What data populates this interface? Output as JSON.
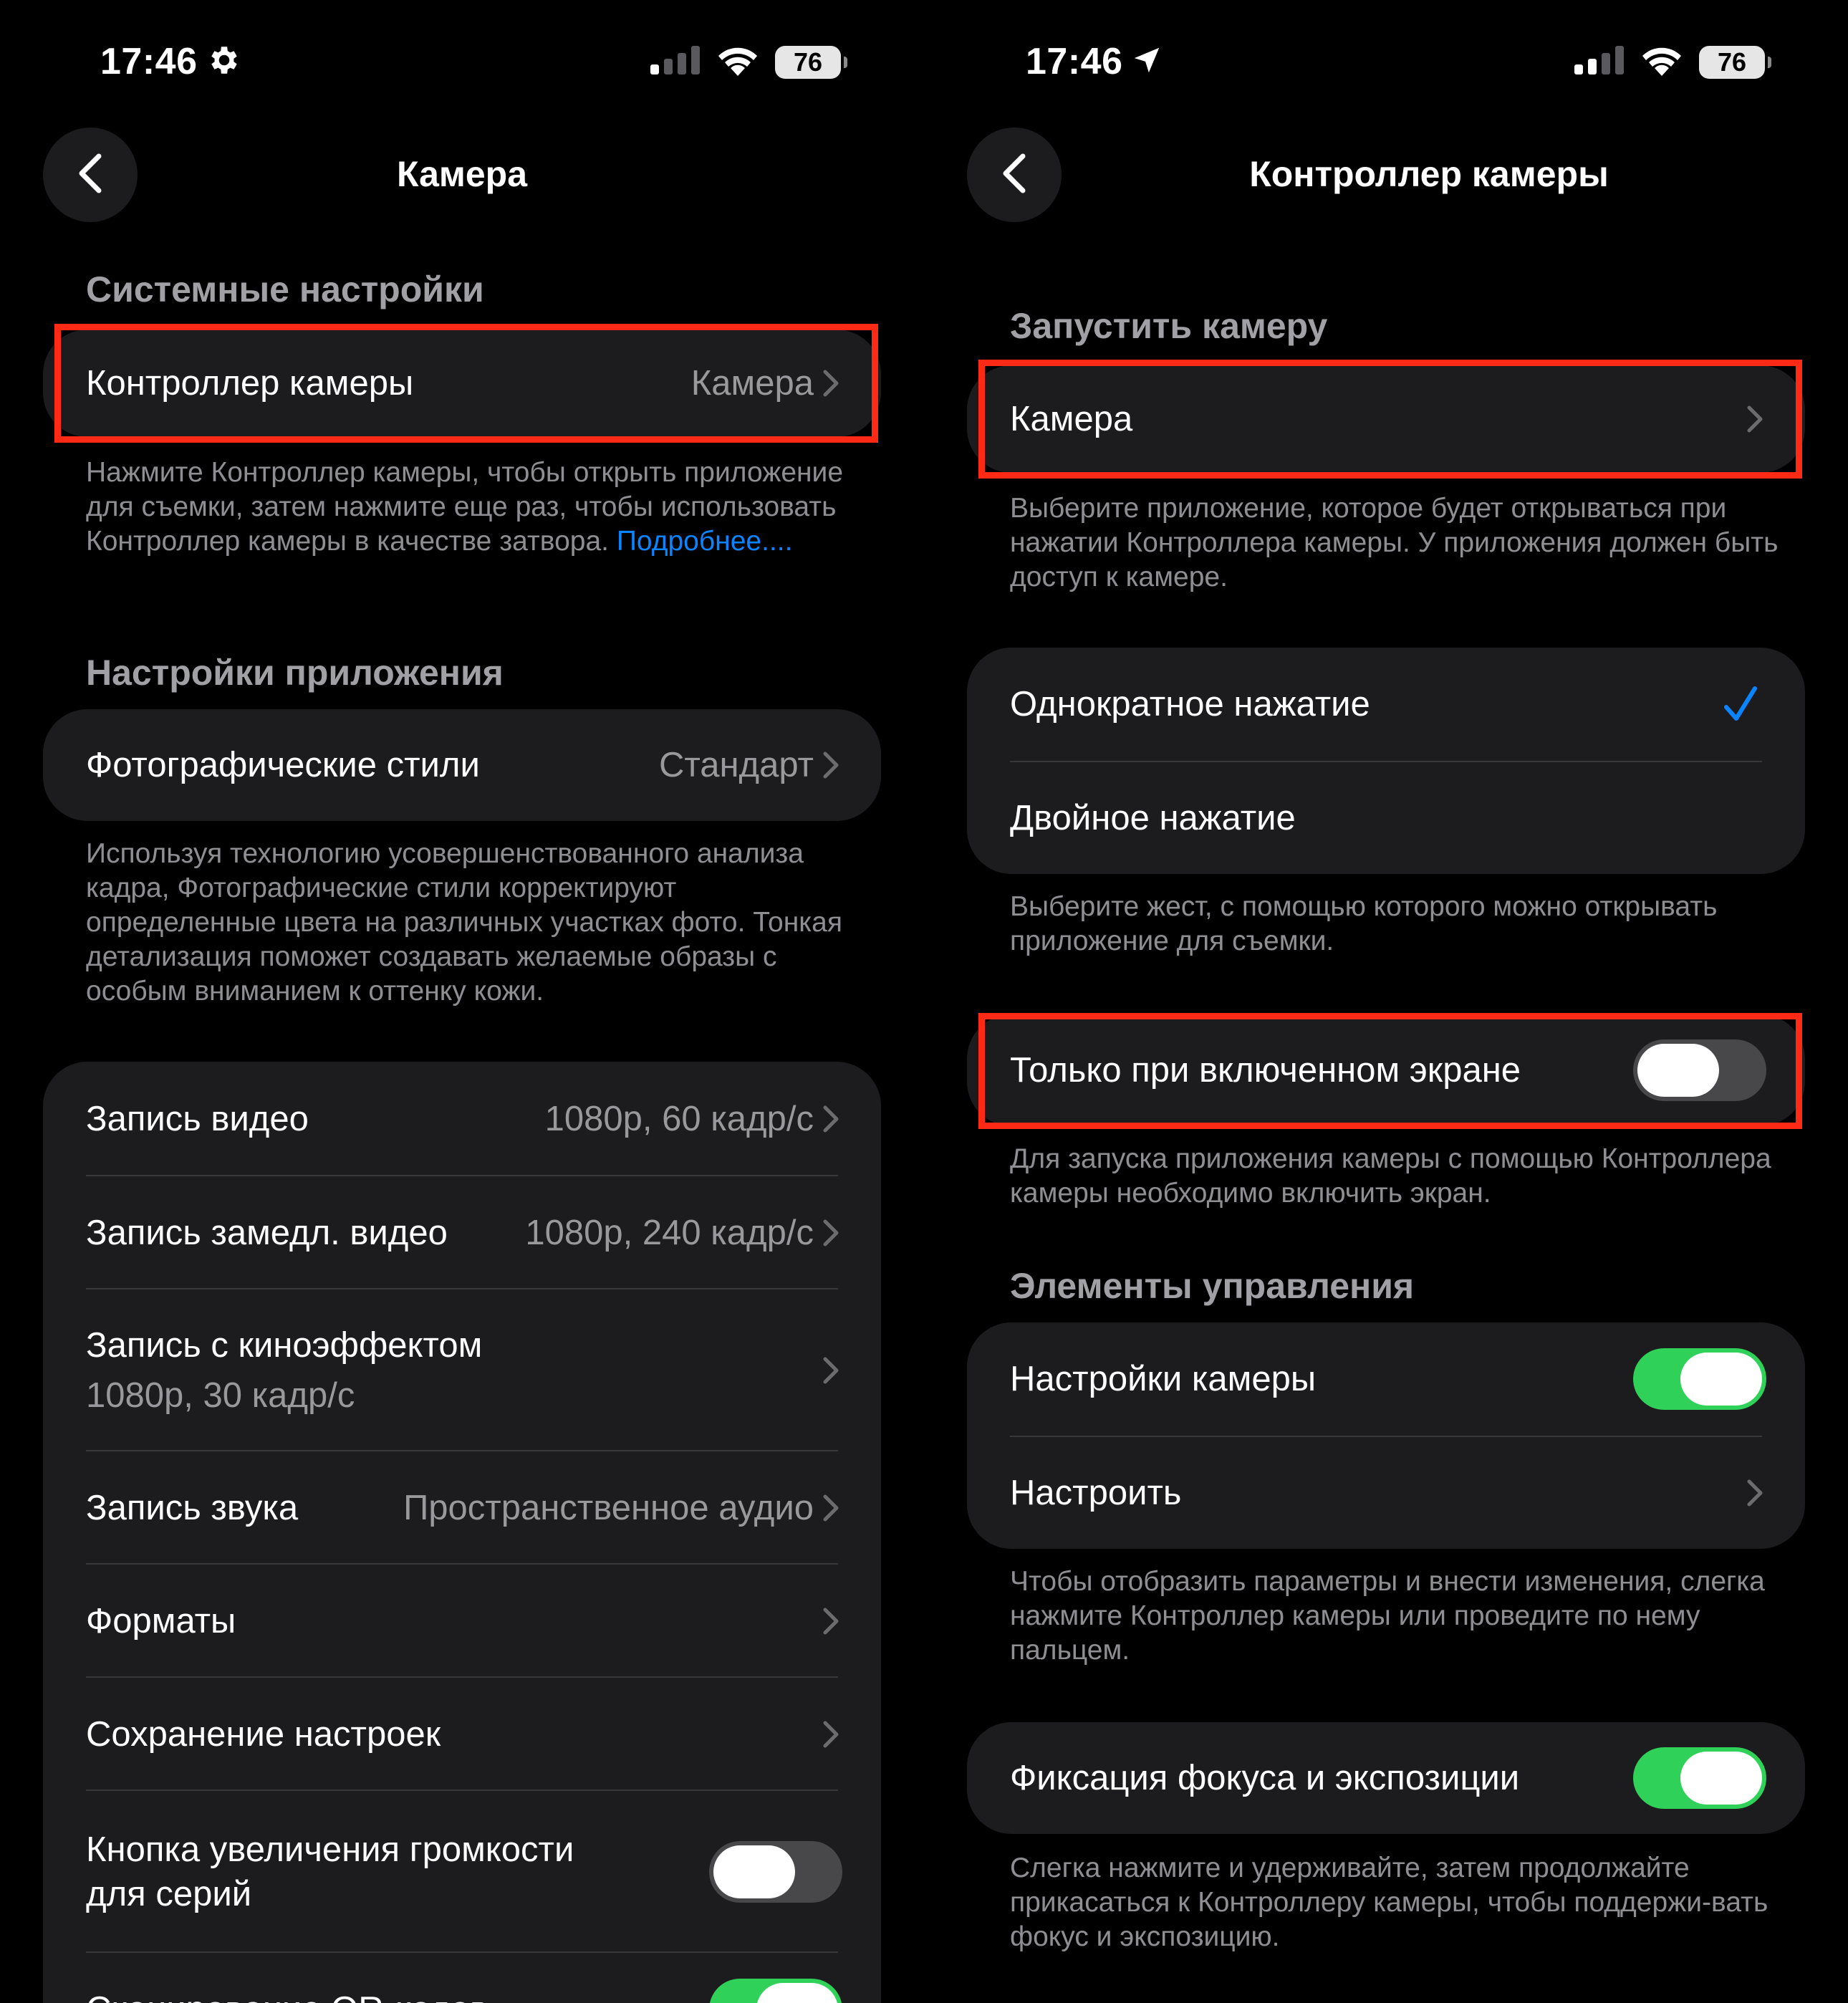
{
  "left": {
    "status": {
      "time": "17:46",
      "battery": "76"
    },
    "nav_title": "Камера",
    "section_system": "Системные настройки",
    "camera_controller": {
      "label": "Контроллер камеры",
      "value": "Камера"
    },
    "footnote_controller": "Нажмите Контроллер камеры, чтобы открыть приложение для съемки, затем нажмите еще раз, чтобы использовать Контроллер камеры в качестве затвора.",
    "footnote_link": "Подробнее....",
    "section_app": "Настройки приложения",
    "photo_styles": {
      "label": "Фотографические стили",
      "value": "Стандарт"
    },
    "footnote_styles": "Используя технологию усовершенствованного анализа кадра, Фотографические стили корректируют определенные цвета на различных участках фото. Тонкая детализация поможет создавать желаемые образы с особым вниманием к оттенку кожи.",
    "rows": {
      "video": {
        "label": "Запись видео",
        "value": "1080p, 60 кадр/с"
      },
      "slomo": {
        "label": "Запись замедл. видео",
        "value": "1080p, 240 кадр/с"
      },
      "cinematic": {
        "label": "Запись с киноэффектом",
        "value": "1080p, 30 кадр/с"
      },
      "audio": {
        "label": "Запись звука",
        "value": "Пространственное аудио"
      },
      "formats": {
        "label": "Форматы"
      },
      "preserve": {
        "label": "Сохранение настроек"
      },
      "volume_burst": {
        "label_line1": "Кнопка увеличения громкости",
        "label_line2": "для серий"
      },
      "qr": {
        "label": "Сканирование QR-кодов"
      }
    }
  },
  "right": {
    "status": {
      "time": "17:46",
      "battery": "76"
    },
    "nav_title": "Контроллер камеры",
    "section_launch": "Запустить камеру",
    "camera_app": {
      "label": "Камера"
    },
    "footnote_app": "Выберите приложение, которое будет открываться при нажатии Контроллера камеры. У приложения должен быть доступ к камере.",
    "single_press": {
      "label": "Однократное нажатие"
    },
    "double_press": {
      "label": "Двойное нажатие"
    },
    "footnote_gesture": "Выберите жест, с помощью которого можно открывать приложение для съемки.",
    "screen_on_only": {
      "label": "Только при включенном экране"
    },
    "footnote_screen": "Для запуска приложения камеры с помощью Контроллера камеры необходимо включить экран.",
    "section_controls": "Элементы управления",
    "camera_settings": {
      "label": "Настройки камеры"
    },
    "customize": {
      "label": "Настроить"
    },
    "footnote_controls": "Чтобы отобразить параметры и внести изменения, слегка нажмите Контроллер камеры или проведите по нему пальцем.",
    "focus_lock": {
      "label": "Фиксация фокуса и экспозиции"
    },
    "footnote_focus": "Слегка нажмите и удерживайте, затем продолжайте прикасаться к Контроллеру камеры, чтобы поддержи-вать фокус и экспозицию."
  },
  "colors": {
    "accent": "#0a84ff",
    "toggle_on": "#30d158",
    "highlight": "#ff2a16",
    "card": "#1c1c1e"
  }
}
